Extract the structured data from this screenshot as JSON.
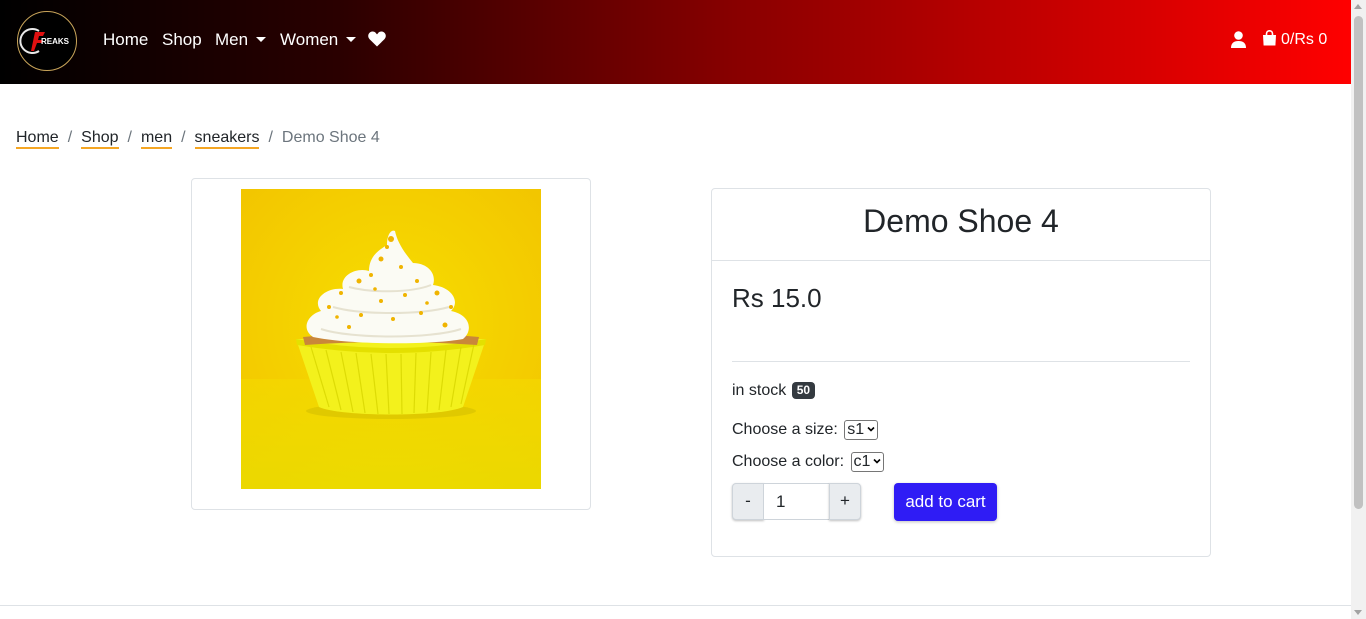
{
  "navbar": {
    "logo_text": "FREAKS",
    "links": {
      "home": "Home",
      "shop": "Shop",
      "men": "Men",
      "women": "Women"
    },
    "cart_summary": "0/Rs 0",
    "gradient_colors": [
      "#000000",
      "#ff0000"
    ]
  },
  "breadcrumb": {
    "items": [
      "Home",
      "Shop",
      "men",
      "sneakers"
    ],
    "current": "Demo Shoe 4",
    "separator": "/",
    "underline_color": "#f5a623"
  },
  "product": {
    "title": "Demo Shoe 4",
    "price": "Rs 15.0",
    "stock_label": "in stock",
    "stock_count": "50",
    "size_label": "Choose a size:",
    "size_selected": "s1",
    "color_label": "Choose a color:",
    "color_selected": "c1",
    "qty_minus": "-",
    "qty_value": "1",
    "qty_plus": "+",
    "add_to_cart": "add to cart",
    "accent_color": "#2f1cf5"
  }
}
